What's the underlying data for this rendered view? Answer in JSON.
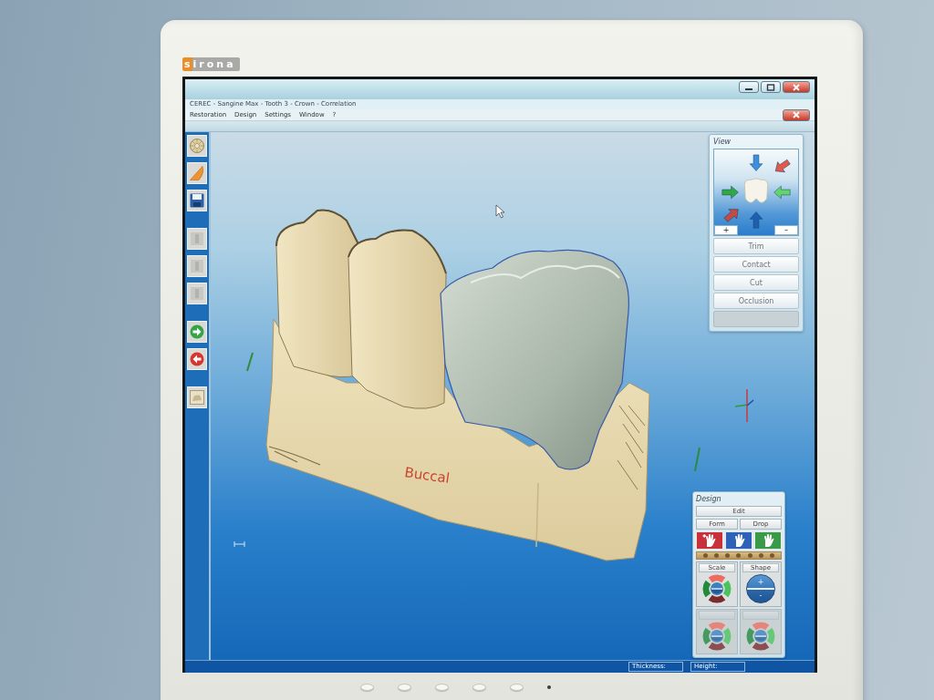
{
  "monitor": {
    "logo": "sirona"
  },
  "window": {
    "title": "CEREC - Sangine Max - Tooth 3 - Crown - Correlation",
    "menu": [
      "Restoration",
      "Design",
      "Settings",
      "Window",
      "?"
    ]
  },
  "viewport": {
    "label": "Buccal"
  },
  "view_panel": {
    "title": "View",
    "zoom_in": "+",
    "zoom_out": "–",
    "buttons": [
      {
        "label": "Trim",
        "disabled": false
      },
      {
        "label": "Contact",
        "disabled": false
      },
      {
        "label": "Cut",
        "disabled": false
      },
      {
        "label": "Occlusion",
        "disabled": false
      },
      {
        "disabled": true
      }
    ]
  },
  "design_panel": {
    "title": "Design",
    "edit": "Edit",
    "modes": [
      "Form",
      "Drop"
    ],
    "groups": [
      {
        "label": "Scale",
        "kind": "ring",
        "disabled": false
      },
      {
        "label": "Shape",
        "kind": "disc",
        "disabled": false,
        "symbols": [
          "+",
          "-"
        ]
      },
      {
        "kind": "ring",
        "disabled": true
      },
      {
        "kind": "ring",
        "disabled": true
      }
    ]
  },
  "status_bar": {
    "fields": [
      "Thickness:",
      "Height:"
    ]
  }
}
